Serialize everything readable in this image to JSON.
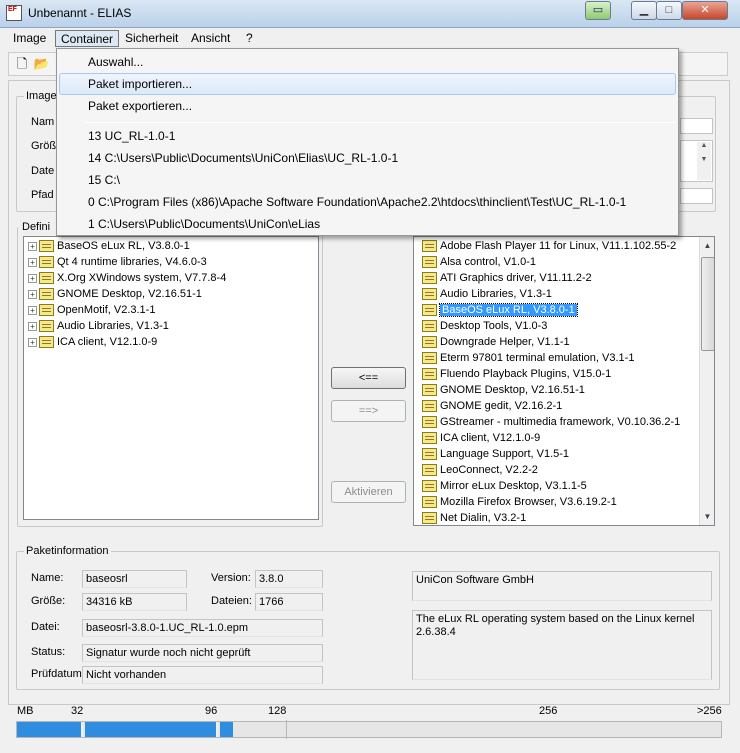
{
  "window": {
    "title": "Unbenannt - ELIAS",
    "icon_text": "EF"
  },
  "menubar": [
    "Image",
    "Container",
    "Sicherheit",
    "Ansicht",
    "?"
  ],
  "image_group": {
    "label": "Image",
    "fields": [
      "Nam",
      "Größ",
      "Date",
      "Pfad"
    ]
  },
  "definition_label": "Defini",
  "left_tree": [
    "BaseOS eLux RL, V3.8.0-1",
    "Qt 4 runtime libraries, V4.6.0-3",
    "X.Org XWindows system, V7.7.8-4",
    "GNOME Desktop, V2.16.51-1",
    "OpenMotif, V2.3.1-1",
    "Audio Libraries, V1.3-1",
    "ICA client, V12.1.0-9"
  ],
  "right_list": [
    "Adobe Flash Player 11 for Linux, V11.1.102.55-2",
    "Alsa control, V1.0-1",
    "ATI Graphics driver, V11.11.2-2",
    "Audio Libraries, V1.3-1",
    "BaseOS eLux RL, V3.8.0-1",
    "Desktop Tools, V1.0-3",
    "Downgrade Helper, V1.1-1",
    "Eterm 97801 terminal emulation, V3.1-1",
    "Fluendo Playback Plugins, V15.0-1",
    "GNOME Desktop, V2.16.51-1",
    "GNOME gedit, V2.16.2-1",
    "GStreamer - multimedia framework, V0.10.36.2-1",
    "ICA client, V12.1.0-9",
    "Language Support, V1.5-1",
    "LeoConnect, V2.2-2",
    "Mirror eLux Desktop, V3.1.1-5",
    "Mozilla Firefox Browser, V3.6.19.2-1",
    "Net Dialin, V3.2-1"
  ],
  "right_selected_index": 4,
  "buttons": {
    "remove": "<==",
    "add": "==>",
    "activate": "Aktivieren"
  },
  "paket": {
    "label": "Paketinformation",
    "name_label": "Name:",
    "name": "baseosrl",
    "version_label": "Version:",
    "version": "3.8.0",
    "size_label": "Größe:",
    "size": "34316 kB",
    "files_label": "Dateien:",
    "files": "1766",
    "file_label": "Datei:",
    "file": "baseosrl-3.8.0-1.UC_RL-1.0.epm",
    "status_label": "Status:",
    "status": "Signatur wurde noch nicht geprüft",
    "checkdate_label": "Prüfdatum:",
    "checkdate": "Nicht vorhanden",
    "vendor": "UniCon Software GmbH",
    "description": "The eLux RL operating system based on the Linux kernel 2.6.38.4"
  },
  "capacity": {
    "labels": [
      "MB",
      "32",
      "96",
      "128",
      "256",
      ">256"
    ],
    "used_fraction": 0.3
  },
  "container_menu": {
    "items": [
      "Auswahl...",
      "Paket importieren...",
      "Paket exportieren..."
    ],
    "recent": [
      "13 UC_RL-1.0-1",
      "14 C:\\Users\\Public\\Documents\\UniCon\\Elias\\UC_RL-1.0-1",
      "15 C:\\",
      "0 C:\\Program Files (x86)\\Apache Software Foundation\\Apache2.2\\htdocs\\thinclient\\Test\\UC_RL-1.0-1",
      "1 C:\\Users\\Public\\Documents\\UniCon\\eLias"
    ],
    "hover_index": 1
  },
  "colors": {
    "selection": "#3399ff",
    "capacity": "#2f8de0"
  }
}
